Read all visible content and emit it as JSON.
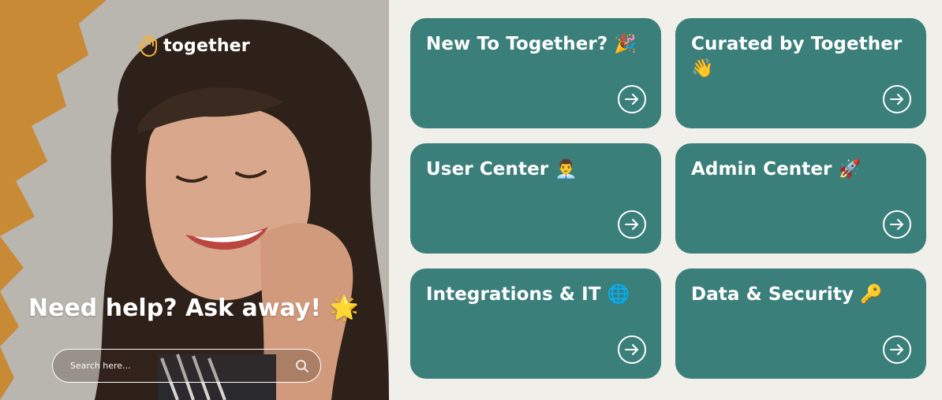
{
  "hero": {
    "brand_name": "together",
    "headline": "Need help? Ask away! 🌟",
    "search": {
      "placeholder": "Search here...",
      "value": ""
    }
  },
  "cards": [
    {
      "title": "New To Together? 🎉"
    },
    {
      "title": "Curated by Together 👋"
    },
    {
      "title": "User Center 👨‍💼"
    },
    {
      "title": "Admin Center 🚀"
    },
    {
      "title": "Integrations & IT 🌐"
    },
    {
      "title": "Data & Security 🔑"
    }
  ],
  "colors": {
    "card_background": "#3b7f7b",
    "page_background": "#f1efe9",
    "accent_orange": "#c98a36"
  }
}
